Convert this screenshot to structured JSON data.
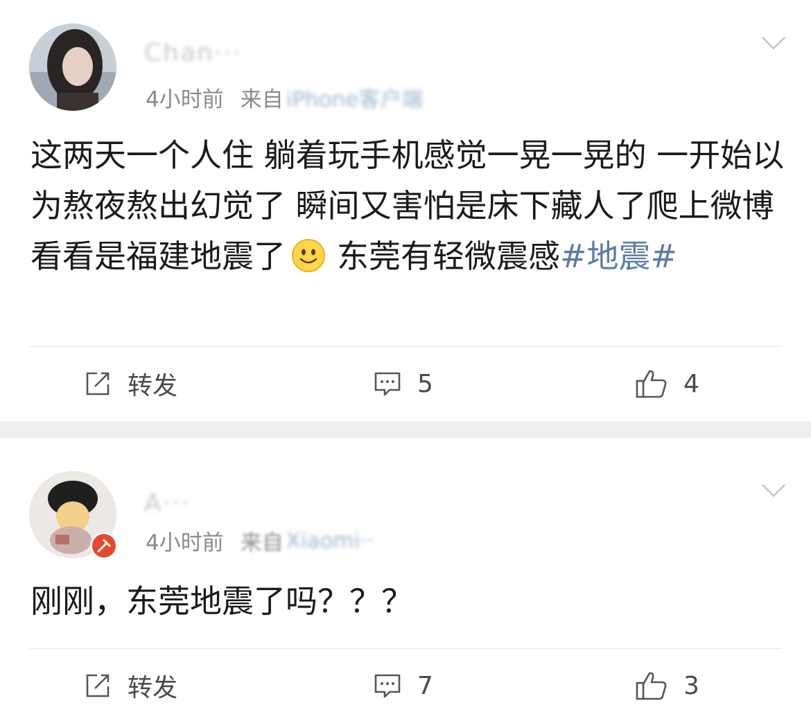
{
  "posts": [
    {
      "username": "Chan···",
      "time": "4小时前",
      "source_prefix": "来自",
      "source_name": "iPhone客户端",
      "content_text": "这两天一个人住 躺着玩手机感觉一晃一晃的 一开始以为熬夜熬出幻觉了 瞬间又害怕是床下藏人了爬上微博看看是福建地震了",
      "content_after_emoji": "东莞有轻微震感",
      "hashtag": "#地震#",
      "emoji": "smile-emoji",
      "repost_label": "转发",
      "comment_count": "5",
      "like_count": "4"
    },
    {
      "username": "A···",
      "time": "4小时前",
      "source_prefix": "来自",
      "source_name": "Xiaomi··",
      "content_text": "刚刚，东莞地震了吗？？？",
      "repost_label": "转发",
      "comment_count": "7",
      "like_count": "3"
    }
  ],
  "colors": {
    "hashtag": "#5b7ba6",
    "meta": "#8a8a8a",
    "separator": "#efefef",
    "badge": "#e6492f"
  }
}
